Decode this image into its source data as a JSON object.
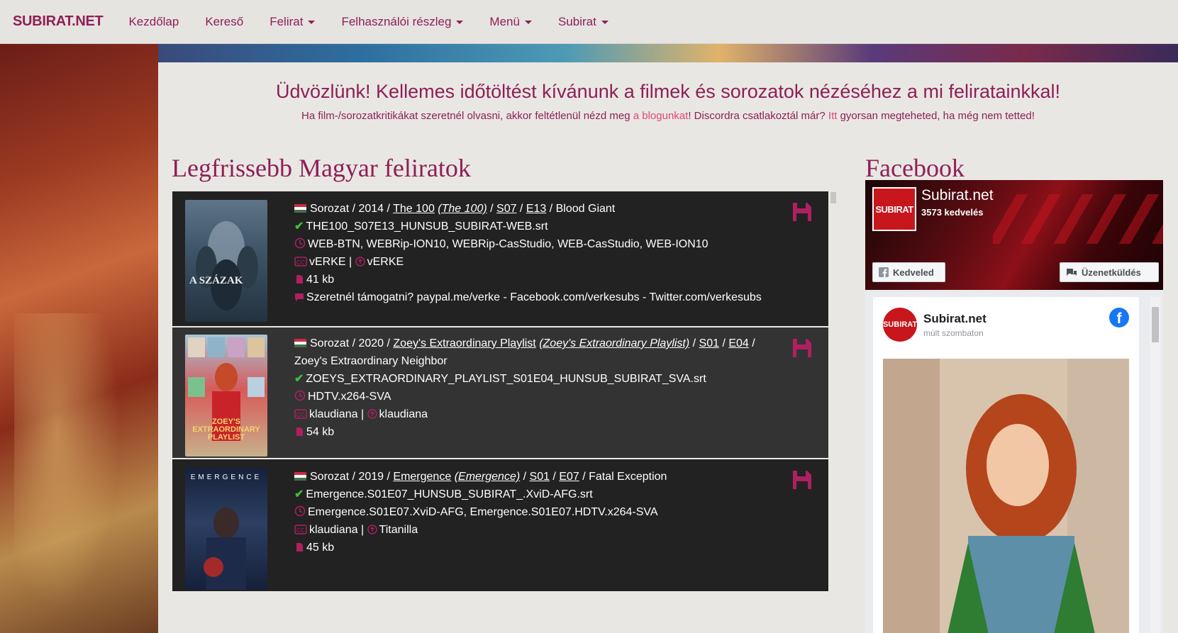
{
  "nav": {
    "brand": "SUBIRAT.NET",
    "items": [
      {
        "label": "Kezdőlap",
        "dropdown": false
      },
      {
        "label": "Kereső",
        "dropdown": false
      },
      {
        "label": "Felirat",
        "dropdown": true
      },
      {
        "label": "Felhasználói részleg",
        "dropdown": true
      },
      {
        "label": "Menü",
        "dropdown": true
      },
      {
        "label": "Subirat",
        "dropdown": true
      }
    ]
  },
  "welcome": {
    "title": "Üdvözlünk! Kellemes időtöltést kívánunk a filmek és sorozatok nézéséhez a mi feliratainkkal!",
    "sub_part1": "Ha film-/sorozatkritikákat szeretnél olvasni, akkor feltétlenül nézd meg ",
    "sub_link1": "a blogunkat",
    "sub_part2": "! Discordra csatlakoztál már? ",
    "sub_link2": "Itt",
    "sub_part3": " gyorsan megteheted, ha még nem tetted!"
  },
  "latest": {
    "title": "Legfrissebb Magyar feliratok",
    "entries": [
      {
        "type_year": "Sorozat / 2014 / ",
        "show": "The 100",
        "show_orig": "(The 100)",
        "season": "S07",
        "episode": "E13",
        "ep_title": " / Blood Giant",
        "filename": "THE100_S07E13_HUNSUB_SUBIRAT-WEB.srt",
        "releases": "WEB-BTN, WEBRip-ION10, WEBRip-CasStudio, WEB-CasStudio, WEB-ION10",
        "translator": "vERKE",
        "uploader": "vERKE",
        "size": "41 kb",
        "comment": "Szeretnél támogatni? paypal.me/verke - Facebook.com/verkesubs - Twitter.com/verkesubs",
        "poster_text": "A SZÁZAK"
      },
      {
        "type_year": "Sorozat / 2020 / ",
        "show": "Zoey's Extraordinary Playlist",
        "show_orig": "(Zoey's Extraordinary Playlist)",
        "season": "S01",
        "episode": "E04",
        "ep_title": " / Zoey's Extraordinary Neighbor",
        "filename": "ZOEYS_EXTRAORDINARY_PLAYLIST_S01E04_HUNSUB_SUBIRAT_SVA.srt",
        "releases": "HDTV.x264-SVA",
        "translator": "klaudiana",
        "uploader": "klaudiana",
        "size": "54 kb",
        "poster_text": "ZOEY'S EXTRAORDINARY PLAYLIST"
      },
      {
        "type_year": "Sorozat / 2019 / ",
        "show": "Emergence",
        "show_orig": "(Emergence)",
        "season": "S01",
        "episode": "E07",
        "ep_title": " / Fatal Exception",
        "filename": "Emergence.S01E07_HUNSUB_SUBIRAT_.XviD-AFG.srt",
        "releases": "Emergence.S01E07.XviD-AFG, Emergence.S01E07.HDTV.x264-SVA",
        "translator": "klaudiana",
        "uploader": "Titanilla",
        "size": "45 kb",
        "poster_text": "EMERGENCE"
      }
    ]
  },
  "facebook": {
    "title": "Facebook",
    "page_name": "Subirat.net",
    "likes": "3573 kedvelés",
    "logo_text": "SUBIRAT",
    "like_button": "Kedveled",
    "message_button": "Üzenetküldés",
    "post_name": "Subirat.net",
    "post_time": "múlt szombaton"
  },
  "colors": {
    "accent": "#8e1f55",
    "link": "#e0457a",
    "card_dark": "#222222",
    "card_mid": "#333333"
  }
}
